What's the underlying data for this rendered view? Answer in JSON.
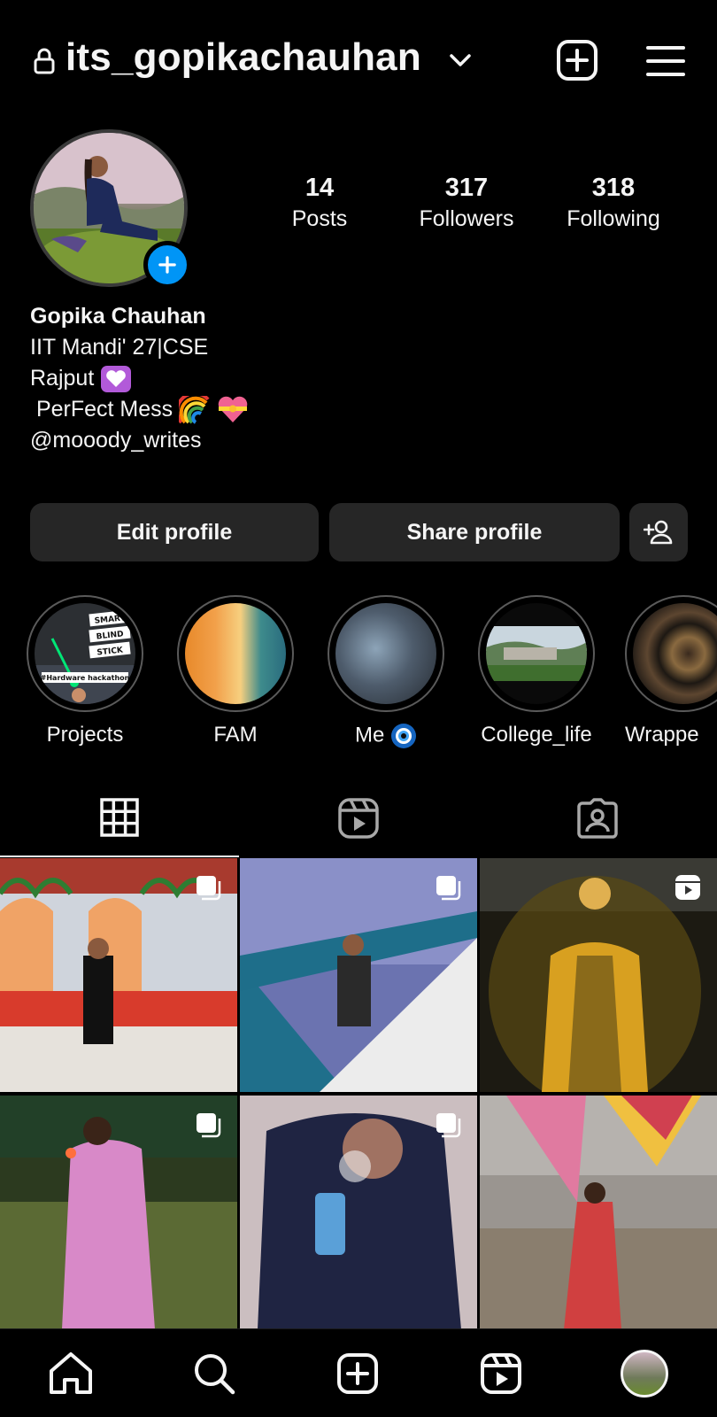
{
  "header": {
    "username": "its_gopikachauhan",
    "icons": [
      "lock-icon",
      "chevron-down-icon",
      "new-post-icon",
      "menu-icon"
    ]
  },
  "profile": {
    "stats": [
      {
        "value": "14",
        "label": "Posts"
      },
      {
        "value": "317",
        "label": "Followers"
      },
      {
        "value": "318",
        "label": "Following"
      }
    ],
    "name": "Gopika Chauhan",
    "bio_line1": "IIT Mandi' 27|CSE",
    "bio_line2": "Rajput",
    "bio_line3": " PerFect Mess",
    "bio_handle": "@mooody_writes"
  },
  "actions": {
    "edit": "Edit profile",
    "share": "Share profile"
  },
  "highlights": [
    {
      "label": "Projects"
    },
    {
      "label": "FAM"
    },
    {
      "label": "Me"
    },
    {
      "label": "College_life"
    },
    {
      "label": "Wrappe"
    }
  ],
  "highlight_overlay": {
    "projects_text": [
      "SMART",
      "BLIND",
      "STICK"
    ],
    "projects_caption": "#Hardware hackathon"
  },
  "tabs": [
    "grid-icon",
    "reels-icon",
    "tagged-icon"
  ],
  "bottom_nav": [
    "home-icon",
    "search-icon",
    "create-icon",
    "reels-icon",
    "profile-avatar"
  ],
  "colors": {
    "background": "#000000",
    "button": "#262626",
    "accent": "#0095f6",
    "text": "#f5f5f5"
  }
}
